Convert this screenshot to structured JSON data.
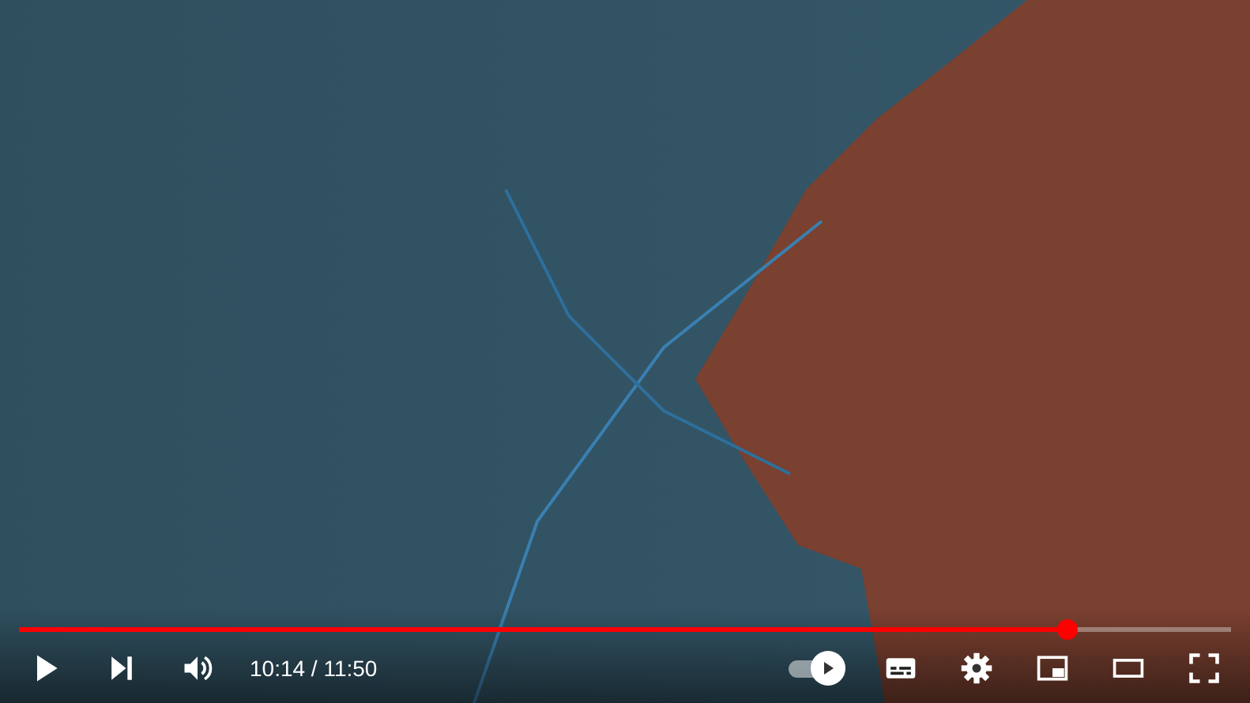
{
  "player": {
    "progress": {
      "level": 0.865
    },
    "controls": [
      {
        "kind": "play"
      },
      {
        "kind": "next"
      },
      {
        "kind": "volume"
      }
    ],
    "time": "10:14 / 11:50",
    "autoplay": {
      "on": true
    },
    "right_controls": [
      {
        "kind": "subtitles"
      },
      {
        "kind": "settings"
      },
      {
        "kind": "miniplayer"
      },
      {
        "kind": "theater"
      },
      {
        "kind": "fullscreen"
      }
    ]
  }
}
